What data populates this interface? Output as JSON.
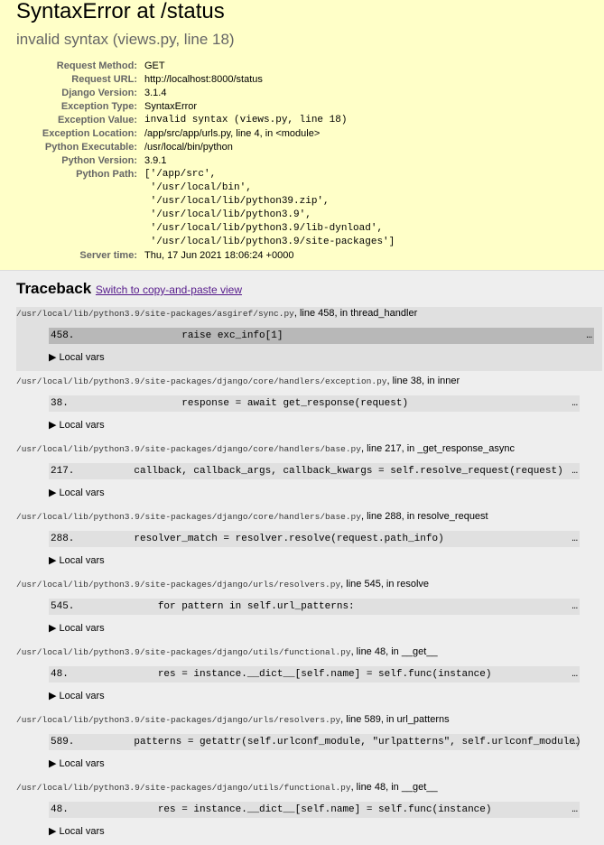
{
  "summary": {
    "title": "SyntaxError at /status",
    "subtitle": "invalid syntax (views.py, line 18)",
    "rows": [
      {
        "label": "Request Method:",
        "value": "GET",
        "mono": false
      },
      {
        "label": "Request URL:",
        "value": "http://localhost:8000/status",
        "mono": false
      },
      {
        "label": "Django Version:",
        "value": "3.1.4",
        "mono": false
      },
      {
        "label": "Exception Type:",
        "value": "SyntaxError",
        "mono": false
      },
      {
        "label": "Exception Value:",
        "value": "invalid syntax (views.py, line 18)",
        "mono": true
      },
      {
        "label": "Exception Location:",
        "value": "/app/src/app/urls.py, line 4, in <module>",
        "mono": false
      },
      {
        "label": "Python Executable:",
        "value": "/usr/local/bin/python",
        "mono": false
      },
      {
        "label": "Python Version:",
        "value": "3.9.1",
        "mono": false
      },
      {
        "label": "Python Path:",
        "value": "['/app/src',\n '/usr/local/bin',\n '/usr/local/lib/python39.zip',\n '/usr/local/lib/python3.9',\n '/usr/local/lib/python3.9/lib-dynload',\n '/usr/local/lib/python3.9/site-packages']",
        "mono": true
      },
      {
        "label": "Server time:",
        "value": "Thu, 17 Jun 2021 18:06:24 +0000",
        "mono": false
      }
    ]
  },
  "traceback": {
    "heading": "Traceback",
    "switch_link": "Switch to copy-and-paste view",
    "local_vars_label": "▶ Local vars",
    "frames": [
      {
        "file": "/usr/local/lib/python3.9/site-packages/asgiref/sync.py",
        "info": ", line 458, in thread_handler",
        "line": "458.",
        "code": "                raise exc_info[1]",
        "user": true
      },
      {
        "file": "/usr/local/lib/python3.9/site-packages/django/core/handlers/exception.py",
        "info": ", line 38, in inner",
        "line": "38.",
        "code": "                response = await get_response(request)",
        "user": false
      },
      {
        "file": "/usr/local/lib/python3.9/site-packages/django/core/handlers/base.py",
        "info": ", line 217, in _get_response_async",
        "line": "217.",
        "code": "        callback, callback_args, callback_kwargs = self.resolve_request(request)",
        "user": false
      },
      {
        "file": "/usr/local/lib/python3.9/site-packages/django/core/handlers/base.py",
        "info": ", line 288, in resolve_request",
        "line": "288.",
        "code": "        resolver_match = resolver.resolve(request.path_info)",
        "user": false
      },
      {
        "file": "/usr/local/lib/python3.9/site-packages/django/urls/resolvers.py",
        "info": ", line 545, in resolve",
        "line": "545.",
        "code": "            for pattern in self.url_patterns:",
        "user": false
      },
      {
        "file": "/usr/local/lib/python3.9/site-packages/django/utils/functional.py",
        "info": ", line 48, in __get__",
        "line": "48.",
        "code": "            res = instance.__dict__[self.name] = self.func(instance)",
        "user": false
      },
      {
        "file": "/usr/local/lib/python3.9/site-packages/django/urls/resolvers.py",
        "info": ", line 589, in url_patterns",
        "line": "589.",
        "code": "        patterns = getattr(self.urlconf_module, \"urlpatterns\", self.urlconf_module)",
        "user": false
      },
      {
        "file": "/usr/local/lib/python3.9/site-packages/django/utils/functional.py",
        "info": ", line 48, in __get__",
        "line": "48.",
        "code": "            res = instance.__dict__[self.name] = self.func(instance)",
        "user": false
      }
    ],
    "ellipsis": "…"
  }
}
